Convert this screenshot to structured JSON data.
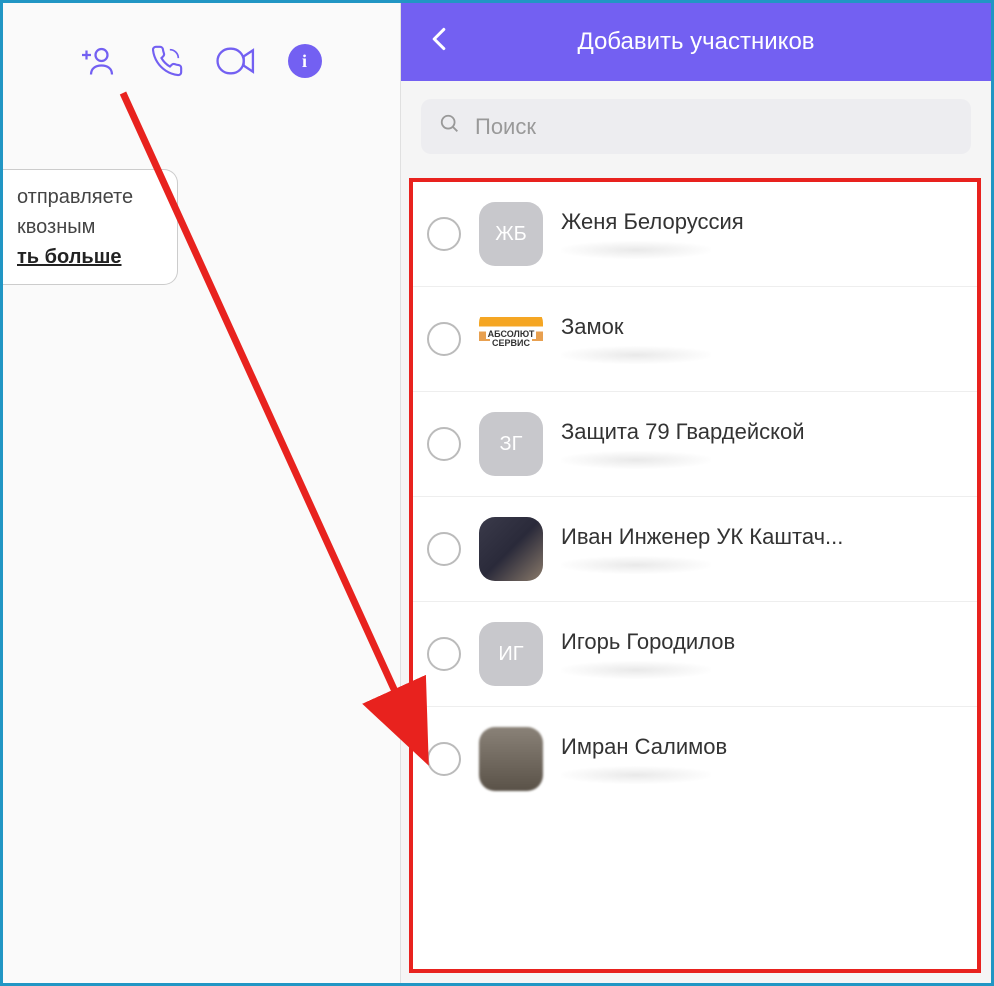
{
  "colors": {
    "accent": "#7360f2",
    "highlight_border": "#e8221e",
    "frame_border": "#2196c4"
  },
  "toolbar": {
    "add_user_icon": "add-user",
    "call_icon": "phone",
    "video_icon": "video",
    "info_icon": "info"
  },
  "snippet": {
    "line1": "отправляете",
    "line2": "квозным",
    "link": "ть больше"
  },
  "header": {
    "title": "Добавить участников",
    "back": "‹"
  },
  "search": {
    "placeholder": "Поиск"
  },
  "contacts": [
    {
      "name": "Женя Белоруссия",
      "initials": "ЖБ",
      "avatar_type": "initials"
    },
    {
      "name": "Замок",
      "initials": "",
      "avatar_type": "logo",
      "logo_top": "АБСОЛЮТ",
      "logo_bottom": "СЕРВИС"
    },
    {
      "name": "Защита 79 Гвардейской",
      "initials": "ЗГ",
      "avatar_type": "initials"
    },
    {
      "name": "Иван Инженер УК Каштач...",
      "initials": "",
      "avatar_type": "photo"
    },
    {
      "name": "Игорь Городилов",
      "initials": "ИГ",
      "avatar_type": "initials"
    },
    {
      "name": "Имран Салимов",
      "initials": "",
      "avatar_type": "photo2"
    }
  ]
}
